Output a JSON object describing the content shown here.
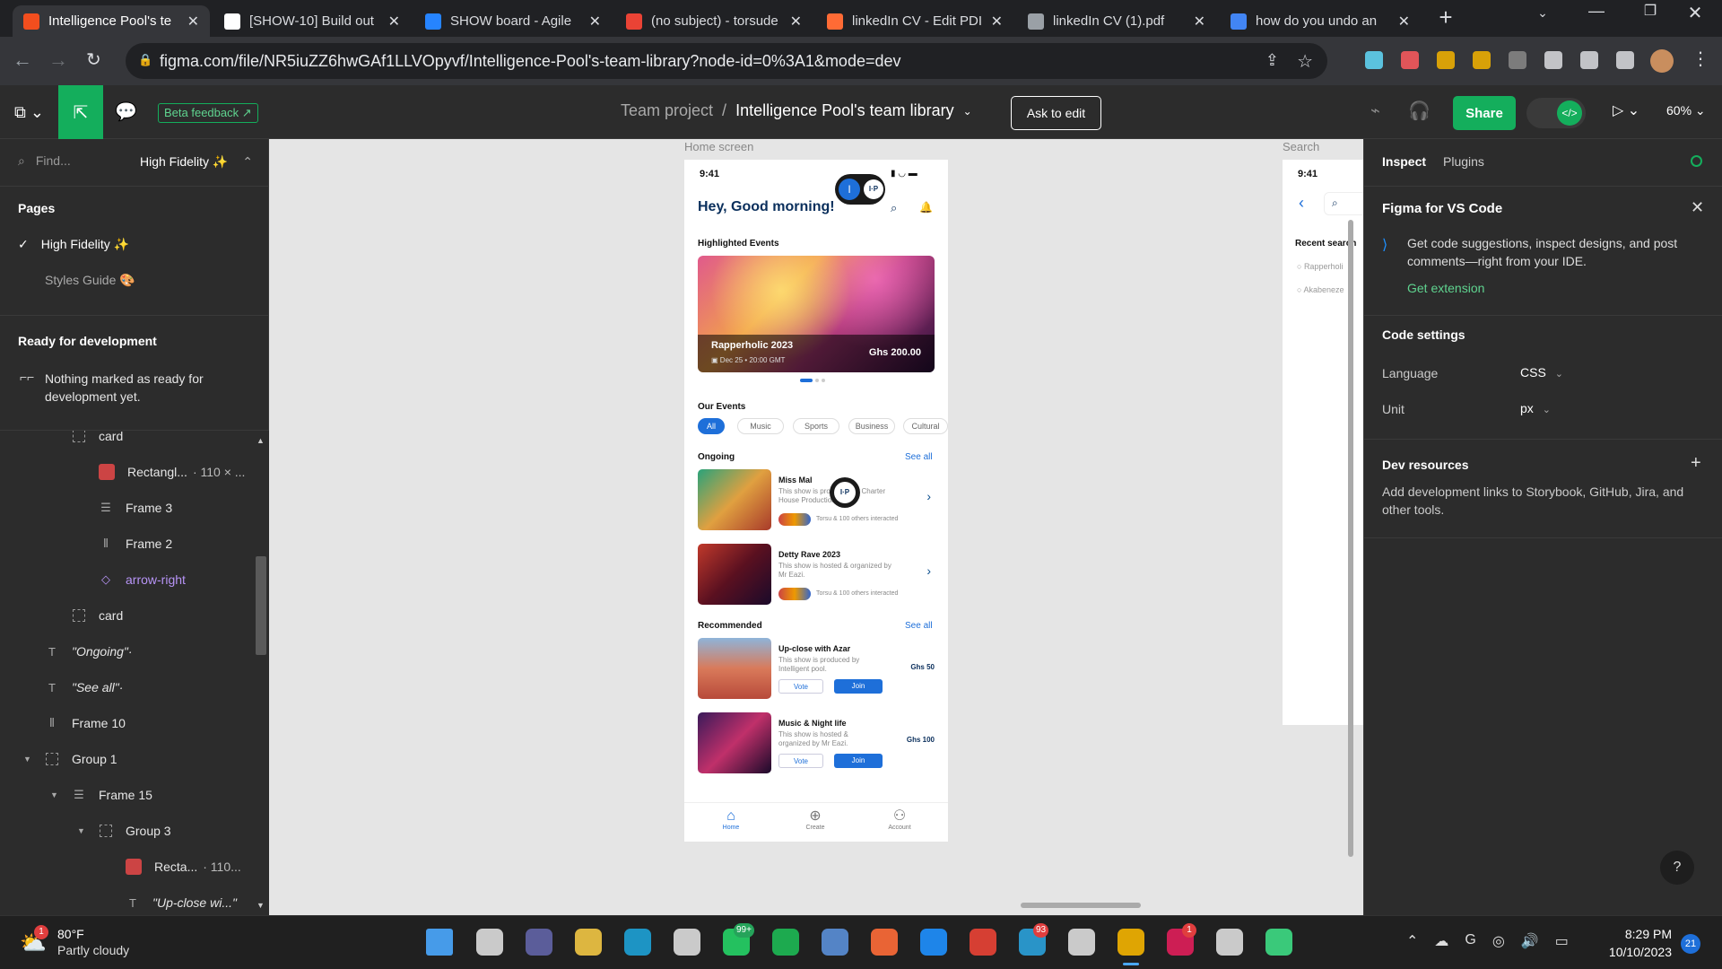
{
  "browser": {
    "tabs": [
      {
        "title": "Intelligence Pool's te",
        "icon": "figma-icon",
        "color": "#f24e1e",
        "active": true
      },
      {
        "title": "[SHOW-10] Build out",
        "icon": "github-icon",
        "color": "#ffffff"
      },
      {
        "title": "SHOW board - Agile",
        "icon": "jira-icon",
        "color": "#2684ff"
      },
      {
        "title": "(no subject) - torsude",
        "icon": "gmail-icon",
        "color": "#ea4335"
      },
      {
        "title": "linkedIn CV - Edit PDI",
        "icon": "pdf-editor-icon",
        "color": "#ff6b35"
      },
      {
        "title": "linkedIn CV (1).pdf",
        "icon": "globe-icon",
        "color": "#9aa0a6"
      },
      {
        "title": "how do you undo an",
        "icon": "google-icon",
        "color": "#4285f4"
      }
    ],
    "url": "figma.com/file/NR5iuZZ6hwGAf1LLVOpyvf/Intelligence-Pool's-team-library?node-id=0%3A1&mode=dev"
  },
  "figma": {
    "beta_feedback": "Beta feedback",
    "project": "Team project",
    "separator": "/",
    "file_name": "Intelligence Pool's team library",
    "ask_to_edit": "Ask to edit",
    "share": "Share",
    "zoom": "60%"
  },
  "left_panel": {
    "find_placeholder": "Find...",
    "current_page": "High Fidelity ✨",
    "pages_heading": "Pages",
    "pages": [
      "High Fidelity ✨",
      "Styles Guide 🎨"
    ],
    "ready_heading": "Ready for development",
    "ready_empty": "Nothing marked as ready for development yet.",
    "layers": [
      {
        "name": "card",
        "indent": 2,
        "icon": "dash"
      },
      {
        "name": "Rectangl...",
        "extra": "· 110 × ...",
        "indent": 3,
        "icon": "image"
      },
      {
        "name": "Frame 3",
        "indent": 3,
        "icon": "frame-v"
      },
      {
        "name": "Frame 2",
        "indent": 3,
        "icon": "frame-h"
      },
      {
        "name": "arrow-right",
        "indent": 3,
        "icon": "component",
        "purple": true
      },
      {
        "name": "card",
        "indent": 2,
        "icon": "dash"
      },
      {
        "name": "\"Ongoing\"·",
        "indent": 1,
        "icon": "text",
        "italic": true
      },
      {
        "name": "\"See all\"·",
        "indent": 1,
        "icon": "text",
        "italic": true
      },
      {
        "name": "Frame 10",
        "indent": 1,
        "icon": "frame-h"
      },
      {
        "name": "Group 1",
        "indent": 1,
        "icon": "dash",
        "caret": true
      },
      {
        "name": "Frame 15",
        "indent": 2,
        "icon": "frame-v",
        "caret": true
      },
      {
        "name": "Group 3",
        "indent": 3,
        "icon": "dash",
        "caret": true
      },
      {
        "name": "Recta...",
        "extra": "· 110...",
        "indent": 4,
        "icon": "image"
      },
      {
        "name": "\"Up-close wi...\"",
        "indent": 4,
        "icon": "text",
        "italic": true
      }
    ]
  },
  "canvas": {
    "frame1_label": "Home screen",
    "frame2_label": "Search",
    "home": {
      "time": "9:41",
      "greeting": "Hey, Good morning!",
      "highlighted": "Highlighted Events",
      "hero_title": "Rapperholic 2023",
      "hero_date": "Dec 25",
      "hero_time": "20:00 GMT",
      "hero_price": "Ghs 200.00",
      "our_events": "Our Events",
      "filters": [
        "All",
        "Music",
        "Sports",
        "Business",
        "Cultural"
      ],
      "ongoing": "Ongoing",
      "see_all": "See all",
      "ongoing_items": [
        {
          "title": "Miss Mal",
          "desc": "This show is produced by Charter House Productions.",
          "meta": "Torsu & 100 others interacted"
        },
        {
          "title": "Detty Rave 2023",
          "desc": "This show is hosted & organized by Mr Eazi.",
          "meta": "Torsu & 100 others interacted"
        }
      ],
      "recommended": "Recommended",
      "recommended_items": [
        {
          "title": "Up-close with Azar",
          "desc": "This show is produced by Intelligent pool.",
          "price": "Ghs 50",
          "vote": "Vote",
          "join": "Join"
        },
        {
          "title": "Music & Night life",
          "desc": "This show is hosted & organized by Mr Eazi.",
          "price": "Ghs 100",
          "vote": "Vote",
          "join": "Join"
        }
      ],
      "nav": [
        "Home",
        "Create",
        "Account"
      ],
      "avatar_letter": "I",
      "cursor_badge": "I·P"
    },
    "search": {
      "time": "9:41",
      "recent": "Recent search",
      "items": [
        "Rapperholi",
        "Akabeneze"
      ]
    }
  },
  "right_panel": {
    "tabs": [
      "Inspect",
      "Plugins"
    ],
    "vs_title": "Figma for VS Code",
    "vs_desc": "Get code suggestions, inspect designs, and post comments—right from your IDE.",
    "vs_link": "Get extension",
    "code_settings": "Code settings",
    "language_label": "Language",
    "language_value": "CSS",
    "unit_label": "Unit",
    "unit_value": "px",
    "dev_resources": "Dev resources",
    "dev_desc": "Add development links to Storybook, GitHub, Jira, and other tools.",
    "help": "?"
  },
  "taskbar": {
    "temp": "80°F",
    "weather": "Partly cloudy",
    "weather_badge": "1",
    "whatsapp_badge": "99+",
    "telegram_badge": "93",
    "slack_badge": "1",
    "time": "8:29 PM",
    "date": "10/10/2023",
    "notif_count": "21"
  }
}
